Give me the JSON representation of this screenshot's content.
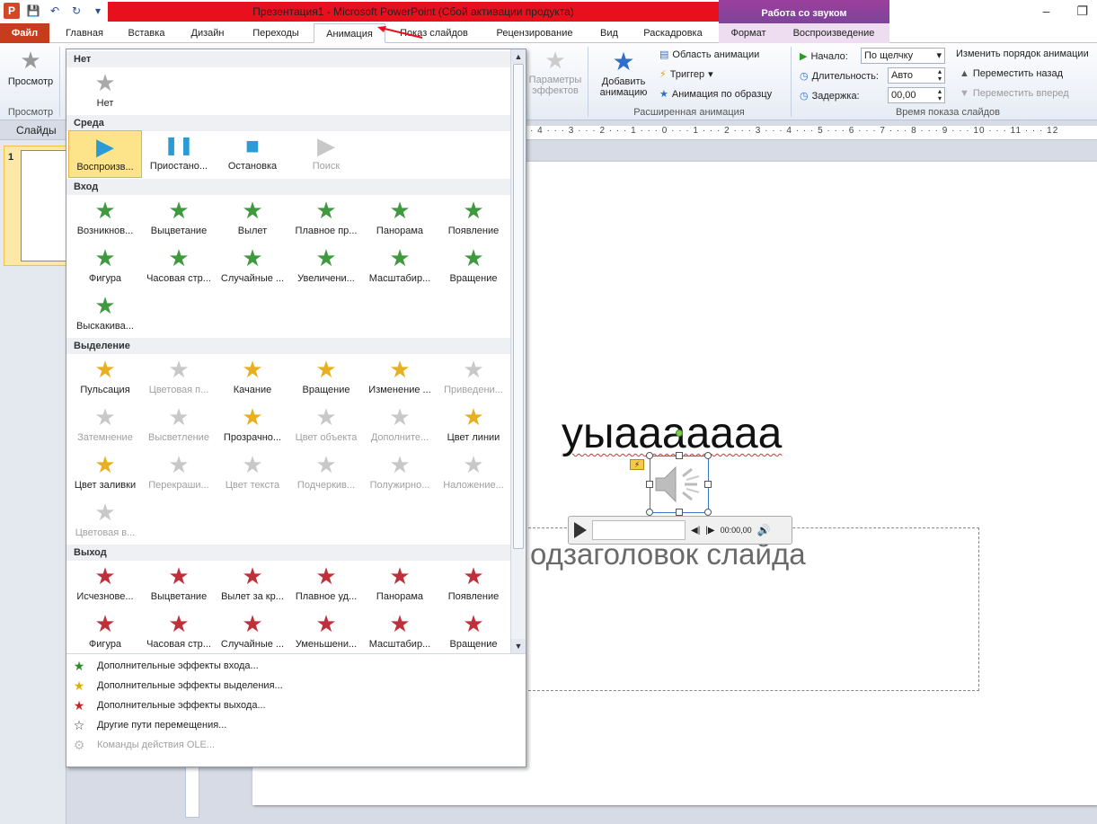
{
  "window": {
    "title": "Презентация1 - Microsoft PowerPoint (Сбой активации продукта)",
    "context_tab_group": "Работа со звуком"
  },
  "tabs": [
    "Файл",
    "Главная",
    "Вставка",
    "Дизайн",
    "Переходы",
    "Анимация",
    "Показ слайдов",
    "Рецензирование",
    "Вид",
    "Раскадровка",
    "Формат",
    "Воспроизведение"
  ],
  "active_tab": "Анимация",
  "ribbon": {
    "preview": {
      "label": "Просмотр",
      "group": "Просмотр"
    },
    "effect_options": "Параметры эффектов",
    "add_animation": "Добавить анимацию",
    "animation_pane": "Область анимации",
    "trigger": "Триггер",
    "animation_painter": "Анимация по образцу",
    "advanced_group": "Расширенная анимация",
    "start_label": "Начало:",
    "start_value": "По щелчку",
    "duration_label": "Длительность:",
    "duration_value": "Авто",
    "delay_label": "Задержка:",
    "delay_value": "00,00",
    "reorder_label": "Изменить порядок анимации",
    "move_earlier": "Переместить назад",
    "move_later": "Переместить вперед",
    "timing_group": "Время показа слайдов"
  },
  "left_pane": {
    "header": "Слайды",
    "slide_number": "1"
  },
  "slide": {
    "title": "уыааааааа",
    "subtitle": "одзаголовок слайда",
    "audio_time": "00:00,00"
  },
  "gallery": {
    "sections": {
      "none": "Нет",
      "media": "Среда",
      "entrance": "Вход",
      "emphasis": "Выделение",
      "exit": "Выход"
    },
    "none_items": [
      {
        "label": "Нет",
        "icon": "star-gray-icon"
      }
    ],
    "media_items": [
      {
        "label": "Воспроизв...",
        "icon": "play-icon"
      },
      {
        "label": "Приостано...",
        "icon": "pause-icon"
      },
      {
        "label": "Остановка",
        "icon": "stop-icon"
      },
      {
        "label": "Поиск",
        "icon": "seek-icon"
      }
    ],
    "entrance_items": [
      {
        "label": "Возникнов...",
        "icon": "star-green-icon"
      },
      {
        "label": "Выцветание",
        "icon": "star-green-icon"
      },
      {
        "label": "Вылет",
        "icon": "star-green-icon"
      },
      {
        "label": "Плавное пр...",
        "icon": "star-green-icon"
      },
      {
        "label": "Панорама",
        "icon": "star-green-icon"
      },
      {
        "label": "Появление",
        "icon": "star-green-icon"
      },
      {
        "label": "Фигура",
        "icon": "star-green-icon"
      },
      {
        "label": "Часовая стр...",
        "icon": "star-green-icon"
      },
      {
        "label": "Случайные ...",
        "icon": "star-green-icon"
      },
      {
        "label": "Увеличени...",
        "icon": "star-green-icon"
      },
      {
        "label": "Масштабир...",
        "icon": "star-green-icon"
      },
      {
        "label": "Вращение",
        "icon": "star-green-icon"
      },
      {
        "label": "Выскакива...",
        "icon": "star-green-icon"
      }
    ],
    "emphasis_items": [
      {
        "label": "Пульсация",
        "icon": "star-gold-icon"
      },
      {
        "label": "Цветовая п...",
        "icon": "star-gray-icon"
      },
      {
        "label": "Качание",
        "icon": "star-gold-icon"
      },
      {
        "label": "Вращение",
        "icon": "star-gold-icon"
      },
      {
        "label": "Изменение ...",
        "icon": "star-gold-icon"
      },
      {
        "label": "Приведени...",
        "icon": "star-gray-icon"
      },
      {
        "label": "Затемнение",
        "icon": "star-gray-icon"
      },
      {
        "label": "Высветление",
        "icon": "star-gray-icon"
      },
      {
        "label": "Прозрачно...",
        "icon": "star-gold-icon"
      },
      {
        "label": "Цвет объекта",
        "icon": "star-gray-icon"
      },
      {
        "label": "Дополните...",
        "icon": "star-gray-icon"
      },
      {
        "label": "Цвет линии",
        "icon": "star-gold-icon"
      },
      {
        "label": "Цвет заливки",
        "icon": "star-gold-icon"
      },
      {
        "label": "Перекраши...",
        "icon": "star-gray-icon"
      },
      {
        "label": "Цвет текста",
        "icon": "star-gray-icon"
      },
      {
        "label": "Подчеркив...",
        "icon": "star-gray-icon"
      },
      {
        "label": "Полужирно...",
        "icon": "star-gray-icon"
      },
      {
        "label": "Наложение...",
        "icon": "star-gray-icon"
      },
      {
        "label": "Цветовая в...",
        "icon": "star-gray-icon"
      }
    ],
    "exit_items": [
      {
        "label": "Исчезнове...",
        "icon": "star-red-icon"
      },
      {
        "label": "Выцветание",
        "icon": "star-red-icon"
      },
      {
        "label": "Вылет за кр...",
        "icon": "star-red-icon"
      },
      {
        "label": "Плавное уд...",
        "icon": "star-red-icon"
      },
      {
        "label": "Панорама",
        "icon": "star-red-icon"
      },
      {
        "label": "Появление",
        "icon": "star-red-icon"
      },
      {
        "label": "Фигура",
        "icon": "star-red-icon"
      },
      {
        "label": "Часовая стр...",
        "icon": "star-red-icon"
      },
      {
        "label": "Случайные ...",
        "icon": "star-red-icon"
      },
      {
        "label": "Уменьшени...",
        "icon": "star-red-icon"
      },
      {
        "label": "Масштабир...",
        "icon": "star-red-icon"
      },
      {
        "label": "Вращение",
        "icon": "star-red-icon"
      }
    ],
    "more": [
      {
        "label": "Дополнительные эффекты входа...",
        "icon": "star-green-icon"
      },
      {
        "label": "Дополнительные эффекты выделения...",
        "icon": "star-gold-icon"
      },
      {
        "label": "Дополнительные эффекты выхода...",
        "icon": "star-red-icon"
      },
      {
        "label": "Другие пути перемещения...",
        "icon": "star-outline-icon"
      },
      {
        "label": "Команды действия OLE...",
        "icon": "gear-icon"
      }
    ]
  },
  "colors": {
    "title_red": "#e8101c",
    "file_tab": "#c83c1e",
    "context_purple": "#8b3f9a"
  }
}
